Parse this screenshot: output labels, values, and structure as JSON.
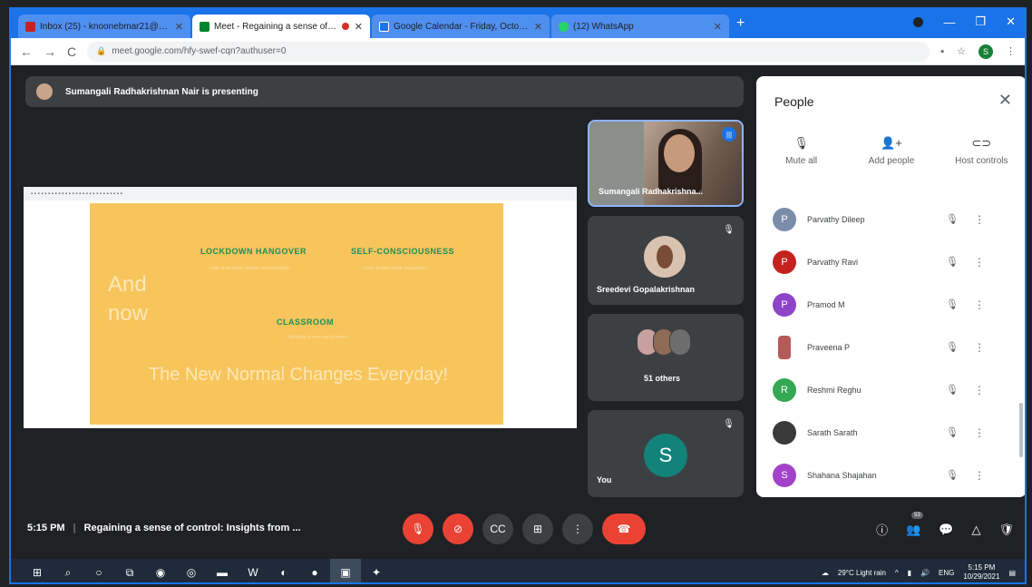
{
  "browser": {
    "tabs": [
      {
        "title": "Inbox (25) - knoonebmar21@gm...",
        "color": "#c5221f"
      },
      {
        "title": "Meet - Regaining a sense of c...",
        "color": "#00832d"
      },
      {
        "title": "Google Calendar - Friday, Octob...",
        "color": "#1a73e8"
      },
      {
        "title": "(12) WhatsApp",
        "color": "#25d366"
      }
    ],
    "url": "meet.google.com/hfy-swef-cqn?authuser=0",
    "profile_initial": "S"
  },
  "presenting_banner": "Sumangali Radhakrishnan Nair is presenting",
  "slide": {
    "and_now": "And now",
    "h1": "LOCKDOWN HANGOVER",
    "h2": "SELF-CONSCIOUSNESS",
    "h3": "CLASSROOM",
    "s1": "Lack of structure, routine and motivation",
    "s2": "Fear, anxiety about appearance",
    "s3": "Adjusting to new social norms",
    "big": "The New Normal Changes Everyday!"
  },
  "tiles": {
    "t1_name": "Sumangali Radhakrishna...",
    "t2_name": "Sreedevi Gopalakrishnan",
    "t3_name": "51 others",
    "t4_name": "You",
    "t4_initial": "S"
  },
  "people": {
    "title": "People",
    "mute_all": "Mute all",
    "add_people": "Add people",
    "host_controls": "Host controls",
    "list": [
      {
        "name": "Parvathy Dileep",
        "initial": "P",
        "color": "#7b8da8"
      },
      {
        "name": "Parvathy Ravi",
        "initial": "P",
        "color": "#c5221f"
      },
      {
        "name": "Pramod M",
        "initial": "P",
        "color": "#8e44c9"
      },
      {
        "name": "Praveena P",
        "initial": "",
        "color": "#b55a5a"
      },
      {
        "name": "Reshmi Reghu",
        "initial": "R",
        "color": "#34a853"
      },
      {
        "name": "Sarath Sarath",
        "initial": "",
        "color": "#3a3a3a"
      },
      {
        "name": "Shahana Shajahan",
        "initial": "S",
        "color": "#a142c8"
      }
    ]
  },
  "bottom": {
    "time": "5:15 PM",
    "meeting_title": "Regaining a sense of control: Insights from ...",
    "people_count": "53"
  },
  "taskbar": {
    "weather": "29°C Light rain",
    "lang": "ENG",
    "time": "5:15 PM",
    "date": "10/29/2021"
  }
}
